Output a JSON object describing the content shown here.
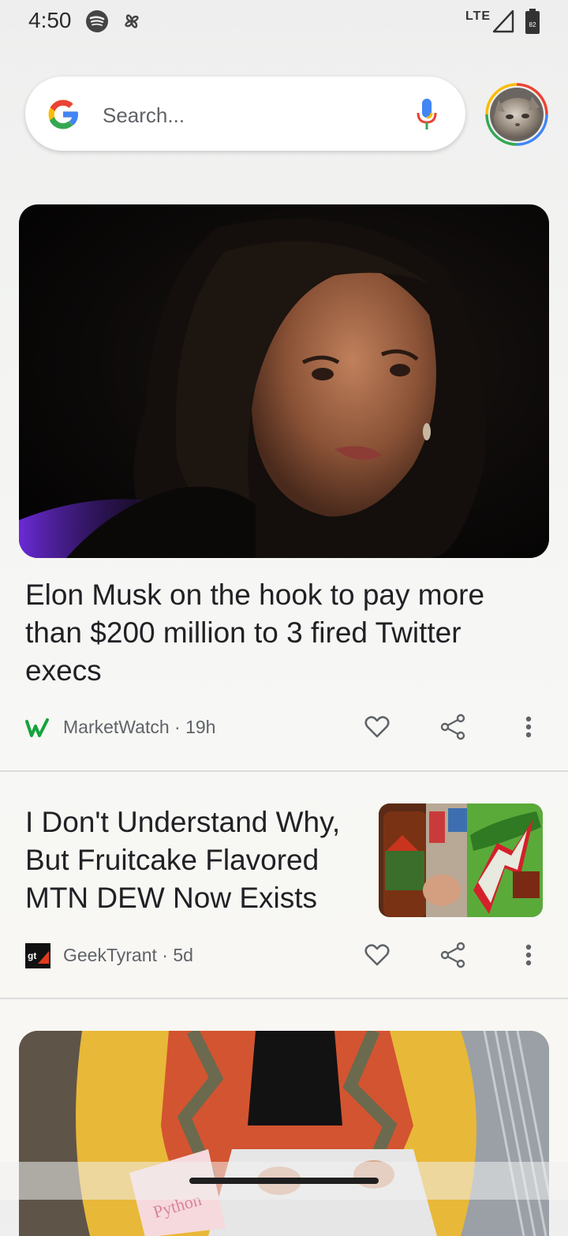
{
  "status_bar": {
    "time": "4:50",
    "network": "LTE",
    "battery_level": "82",
    "icons": [
      "spotify-icon",
      "pinwheel-icon",
      "signal-icon",
      "battery-icon"
    ]
  },
  "search": {
    "placeholder": "Search...",
    "value": "",
    "icons": [
      "google-logo",
      "mic-icon",
      "avatar"
    ]
  },
  "feed": [
    {
      "headline": "Elon Musk on the hook to pay more than $200 million to 3 fired Twitter execs",
      "source": "MarketWatch",
      "age": "19h",
      "image": "photo-woman-portrait"
    },
    {
      "headline": "I Don't Understand Why, But Fruitcake Flavored MTN DEW Now Exists",
      "source": "GeekTyrant",
      "age": "5d",
      "image": "photo-mtn-dew-bottle"
    },
    {
      "image": "photo-person-laptop",
      "image_text": "Python"
    }
  ],
  "separator": "·",
  "colors": {
    "google_blue": "#4285F4",
    "google_red": "#EA4335",
    "google_yellow": "#FBBC05",
    "google_green": "#34A853",
    "text_primary": "#202124",
    "text_secondary": "#5f6368"
  }
}
